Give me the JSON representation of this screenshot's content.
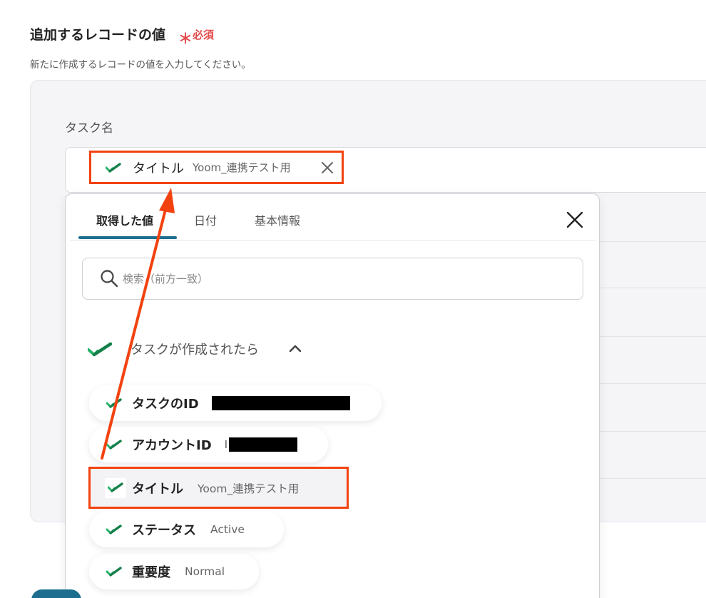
{
  "section": {
    "title": "追加するレコードの値",
    "required_mark": "＊",
    "required_label": "必須",
    "description": "新たに作成するレコードの値を入力してください。"
  },
  "field": {
    "label": "タスク名",
    "chip": {
      "label": "タイトル",
      "value": "Yoom_連携テスト用",
      "icon": "app-logo-icon"
    }
  },
  "dropdown": {
    "tabs": [
      {
        "label": "取得した値",
        "active": true
      },
      {
        "label": "日付",
        "active": false
      },
      {
        "label": "基本情報",
        "active": false
      }
    ],
    "search_placeholder": "検索（前方一致）",
    "group": {
      "label": "タスクが作成されたら",
      "expanded": true
    },
    "items": [
      {
        "label": "タスクのID",
        "value": "",
        "redacted": true
      },
      {
        "label": "アカウントID",
        "value": "I",
        "redacted": true
      },
      {
        "label": "タイトル",
        "value": "Yoom_連携テスト用",
        "highlighted": true
      },
      {
        "label": "ステータス",
        "value": "Active"
      },
      {
        "label": "重要度",
        "value": "Normal"
      }
    ]
  },
  "colors": {
    "accent": "#1d6e8f",
    "annotation": "#f2420f",
    "required": "#e34b4b",
    "logo_green": "#1aa260"
  }
}
